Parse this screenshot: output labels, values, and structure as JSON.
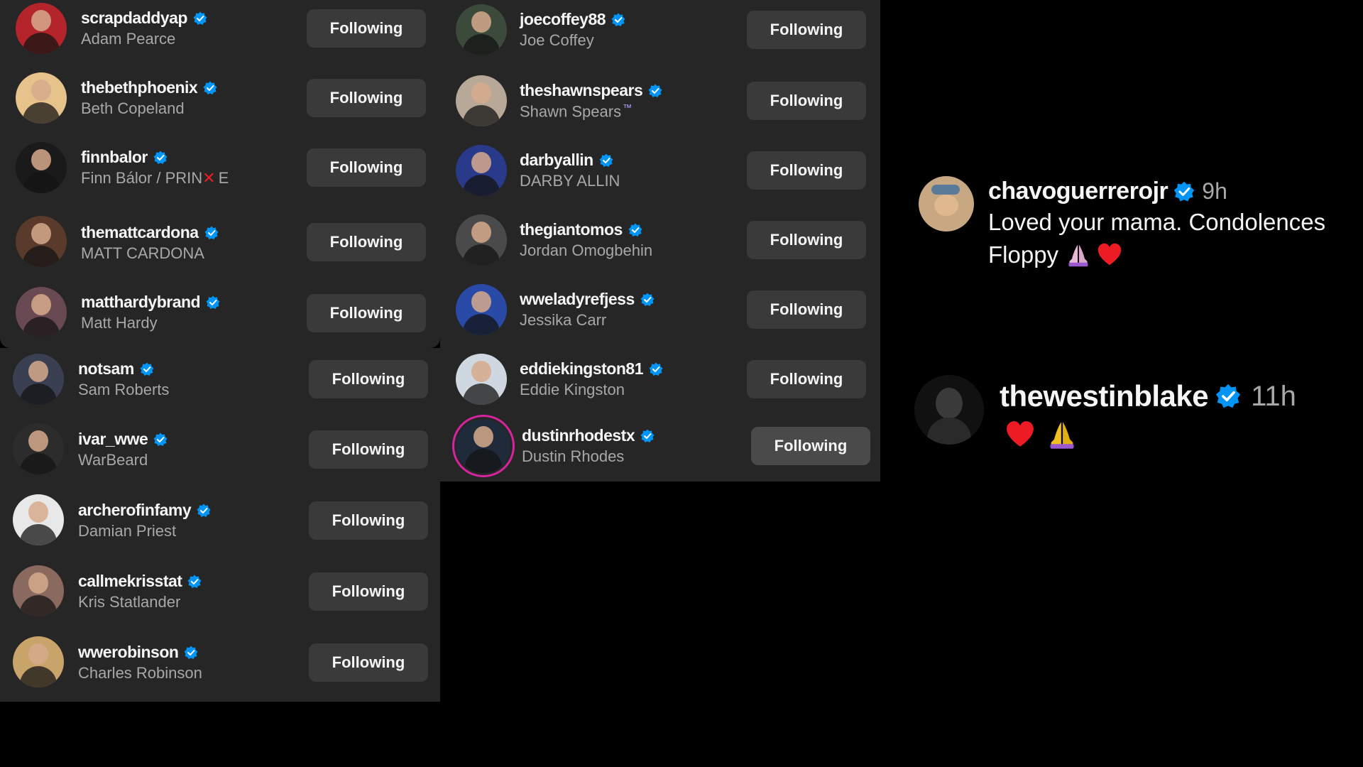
{
  "follow_button_label": "Following",
  "colors": {
    "panel_bg": "#262626",
    "button_bg": "#3a3a3a",
    "verified_blue": "#0095f6",
    "secondary_text": "#a8a8a8",
    "story_ring": "#d6249f",
    "heart_red": "#ed1c24",
    "pray_purple": "#9b59d0"
  },
  "panel_a": {
    "accounts": [
      {
        "username": "scrapdaddyap",
        "full_name": "Adam Pearce",
        "verified": true,
        "avatar_color": "#b3242b"
      },
      {
        "username": "thebethphoenix",
        "full_name": "Beth Copeland",
        "verified": true,
        "avatar_color": "#e6c38a"
      },
      {
        "username": "finnbalor",
        "full_name_prefix": "Finn Bálor / PRIN",
        "full_name_mark": "✕",
        "full_name_suffix": "E",
        "verified": true,
        "avatar_color": "#1a1a1a"
      },
      {
        "username": "themattcardona",
        "full_name": "MATT CARDONA",
        "verified": true,
        "avatar_color": "#5a3a2a"
      },
      {
        "username": "matthardybrand",
        "full_name": "Matt Hardy",
        "verified": true,
        "avatar_color": "#6a4a52"
      }
    ]
  },
  "panel_b": {
    "accounts": [
      {
        "username": "notsam",
        "full_name": "Sam Roberts",
        "verified": true,
        "avatar_color": "#3a3f52"
      },
      {
        "username": "ivar_wwe",
        "full_name": "WarBeard",
        "verified": true,
        "avatar_color": "#2c2c2c"
      },
      {
        "username": "archerofinfamy",
        "full_name": "Damian Priest",
        "verified": true,
        "avatar_color": "#e8e8e8"
      },
      {
        "username": "callmekrisstat",
        "full_name": "Kris Statlander",
        "verified": true,
        "avatar_color": "#8a6a5e"
      },
      {
        "username": "wwerobinson",
        "full_name": "Charles Robinson",
        "verified": true,
        "avatar_color": "#c9a46a"
      }
    ]
  },
  "panel_c": {
    "accounts": [
      {
        "username": "joecoffey88",
        "full_name": "Joe Coffey",
        "verified": true,
        "avatar_color": "#3b4a3a"
      },
      {
        "username": "theshawnspears",
        "full_name": "Shawn Spears",
        "full_name_tm": "™",
        "verified": true,
        "avatar_color": "#b8a898"
      },
      {
        "username": "darbyallin",
        "full_name": "DARBY ALLIN",
        "verified": true,
        "avatar_color": "#2a3a8a"
      },
      {
        "username": "thegiantomos",
        "full_name": "Jordan Omogbehin",
        "verified": true,
        "avatar_color": "#4a4a4a"
      },
      {
        "username": "wweladyrefjess",
        "full_name": "Jessika Carr",
        "verified": true,
        "avatar_color": "#2a4aa8"
      },
      {
        "username": "eddiekingston81",
        "full_name": "Eddie Kingston",
        "verified": true,
        "avatar_color": "#cfd8e0"
      },
      {
        "username": "dustinrhodestx",
        "full_name": "Dustin Rhodes",
        "verified": true,
        "avatar_color": "#1f2a3a",
        "story_ring": true
      }
    ]
  },
  "comments": [
    {
      "username": "chavoguerrerojr",
      "verified": true,
      "time": "9h",
      "text_line1": "Loved your mama. Condolences",
      "text_line2": "Floppy",
      "emojis": [
        "pray-icon",
        "heart-icon"
      ]
    },
    {
      "username": "thewestinblake",
      "verified": true,
      "time": "11h",
      "emojis": [
        "heart-icon",
        "pray-icon"
      ]
    }
  ]
}
